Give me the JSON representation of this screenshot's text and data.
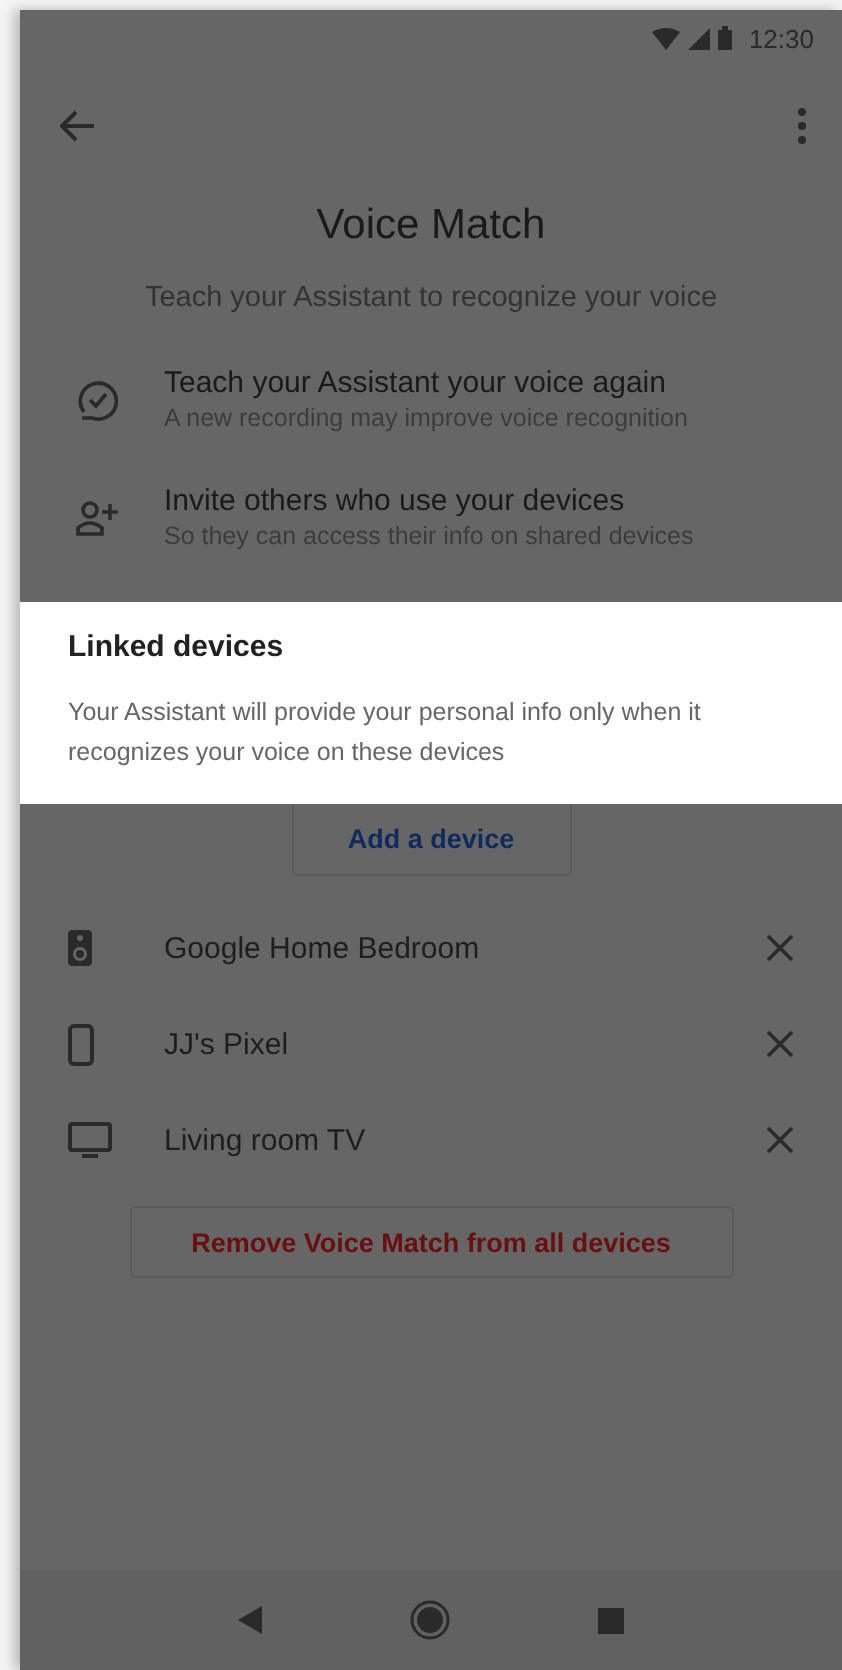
{
  "status_bar": {
    "time": "12:30"
  },
  "title": "Voice Match",
  "subtitle": "Teach your Assistant to recognize your voice",
  "options": [
    {
      "kind": "retrain",
      "title": "Teach your Assistant your voice again",
      "subtitle": "A new recording may improve voice recognition"
    },
    {
      "kind": "invite",
      "title": "Invite others who use your devices",
      "subtitle": "So they can access their info on shared devices"
    }
  ],
  "linked_card": {
    "title": "Linked devices",
    "description": "Your Assistant will provide your personal info only when it recognizes your voice on these devices"
  },
  "add_button": "Add a device",
  "devices": [
    {
      "kind": "speaker",
      "name": "Google Home Bedroom"
    },
    {
      "kind": "phone",
      "name": "JJ's Pixel"
    },
    {
      "kind": "tv",
      "name": "Living room TV"
    }
  ],
  "remove_button": "Remove Voice Match from all devices"
}
